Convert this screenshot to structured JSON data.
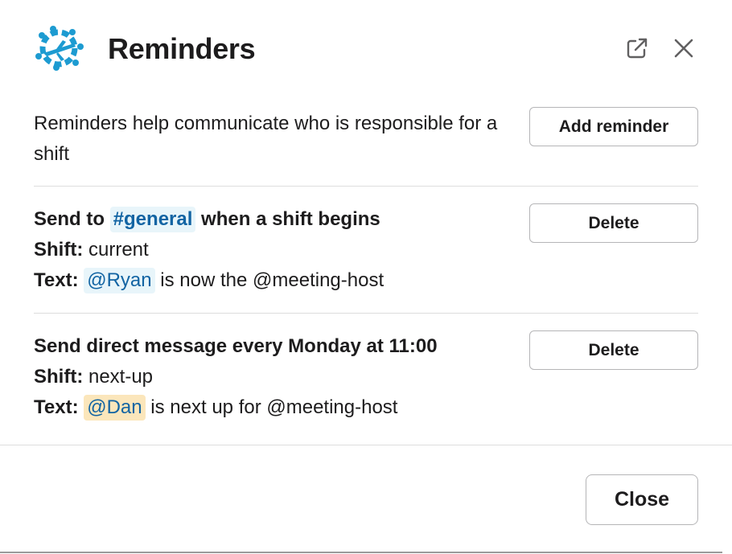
{
  "header": {
    "title": "Reminders",
    "app_icon": "gear-airplane-icon",
    "external_icon": "external-link-icon",
    "close_icon": "close-icon"
  },
  "intro": {
    "text": "Reminders help communicate who is responsible for a shift",
    "add_button": "Add reminder"
  },
  "reminders": [
    {
      "heading_prefix": "Send to ",
      "channel": "#general",
      "heading_suffix": " when a shift begins",
      "shift_label": "Shift:",
      "shift_value": " current",
      "text_label": "Text:",
      "mention": "@Ryan",
      "text_suffix": " is now the @meeting-host",
      "delete_label": "Delete"
    },
    {
      "heading": "Send direct message every Monday at 11:00",
      "shift_label": "Shift:",
      "shift_value": " next-up",
      "text_label": "Text:",
      "mention": "@Dan",
      "text_suffix": " is next up for @meeting-host",
      "delete_label": "Delete"
    }
  ],
  "footer": {
    "close_label": "Close"
  },
  "colors": {
    "accent_icon": "#1d9bd1",
    "link_blue": "#1264a3",
    "chip_blue_bg": "#e8f5fa",
    "chip_yellow_bg": "#fbe6bb"
  }
}
